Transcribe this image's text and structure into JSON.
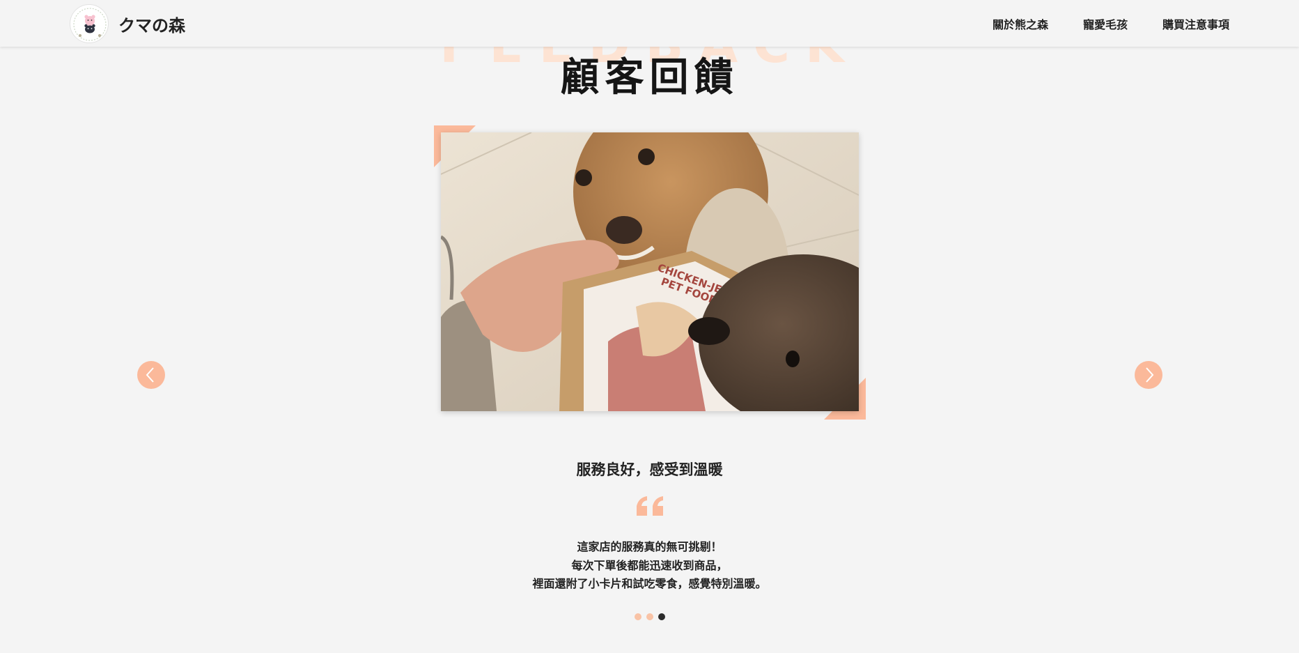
{
  "header": {
    "brand_name": "クマの森",
    "nav": [
      {
        "label": "關於熊之森"
      },
      {
        "label": "寵愛毛孩"
      },
      {
        "label": "購買注意事項"
      }
    ]
  },
  "section": {
    "background_word": "FEEDBACK",
    "title": "顧客回饋"
  },
  "testimonial": {
    "photo_label": "CHICKEN-JERKY PET FOOD",
    "title": "服務良好，感受到溫暖",
    "body_lines": [
      "這家店的服務真的無可挑剔！",
      "每次下單後都能迅速收到商品，",
      "裡面還附了小卡片和試吃零食，感覺特別溫暖。"
    ]
  },
  "carousel": {
    "slide_count": 3,
    "active_index": 2
  },
  "colors": {
    "accent": "#fbb99a",
    "background": "#f4f4f4",
    "text": "#1c1c1c",
    "dot_active": "#2b2b2b"
  },
  "icons": {
    "prev": "chevron-left-icon",
    "next": "chevron-right-icon",
    "quote": "quote-icon"
  }
}
